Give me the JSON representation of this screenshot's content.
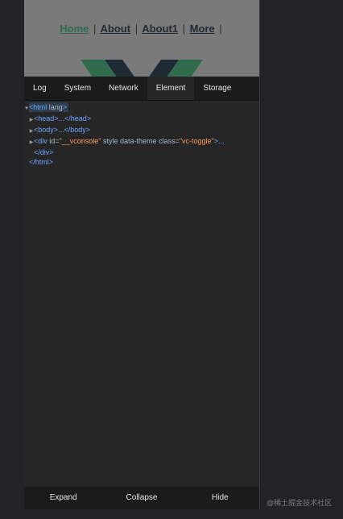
{
  "app": {
    "nav": {
      "home": "Home",
      "about": "About",
      "about1": "About1",
      "more": "More",
      "separator": "|"
    }
  },
  "console": {
    "tabs": [
      "Log",
      "System",
      "Network",
      "Element",
      "Storage"
    ],
    "active_tab": "Element",
    "tree": {
      "html_open_tag": "html",
      "html_open_attr": "lang",
      "head": "<head>...</head>",
      "body": "<body>...</body>",
      "div_open": "<div",
      "div_id_name": "id=",
      "div_id_val": "\"__vconsole\"",
      "div_style": "style",
      "div_theme": "data-theme",
      "div_class_name": "class=",
      "div_class_val": "\"vc-toggle\"",
      "div_tail": ">...",
      "div_close": "</div>",
      "html_close": "</html>"
    },
    "toolbar": {
      "expand": "Expand",
      "collapse": "Collapse",
      "hide": "Hide"
    }
  },
  "watermark": "@稀土掘金技术社区",
  "colors": {
    "vue_green": "#2f6b4c",
    "vue_dark": "#1f2a33",
    "tag_blue": "#6aa6ff",
    "attr_orange": "#ff9a5a"
  }
}
